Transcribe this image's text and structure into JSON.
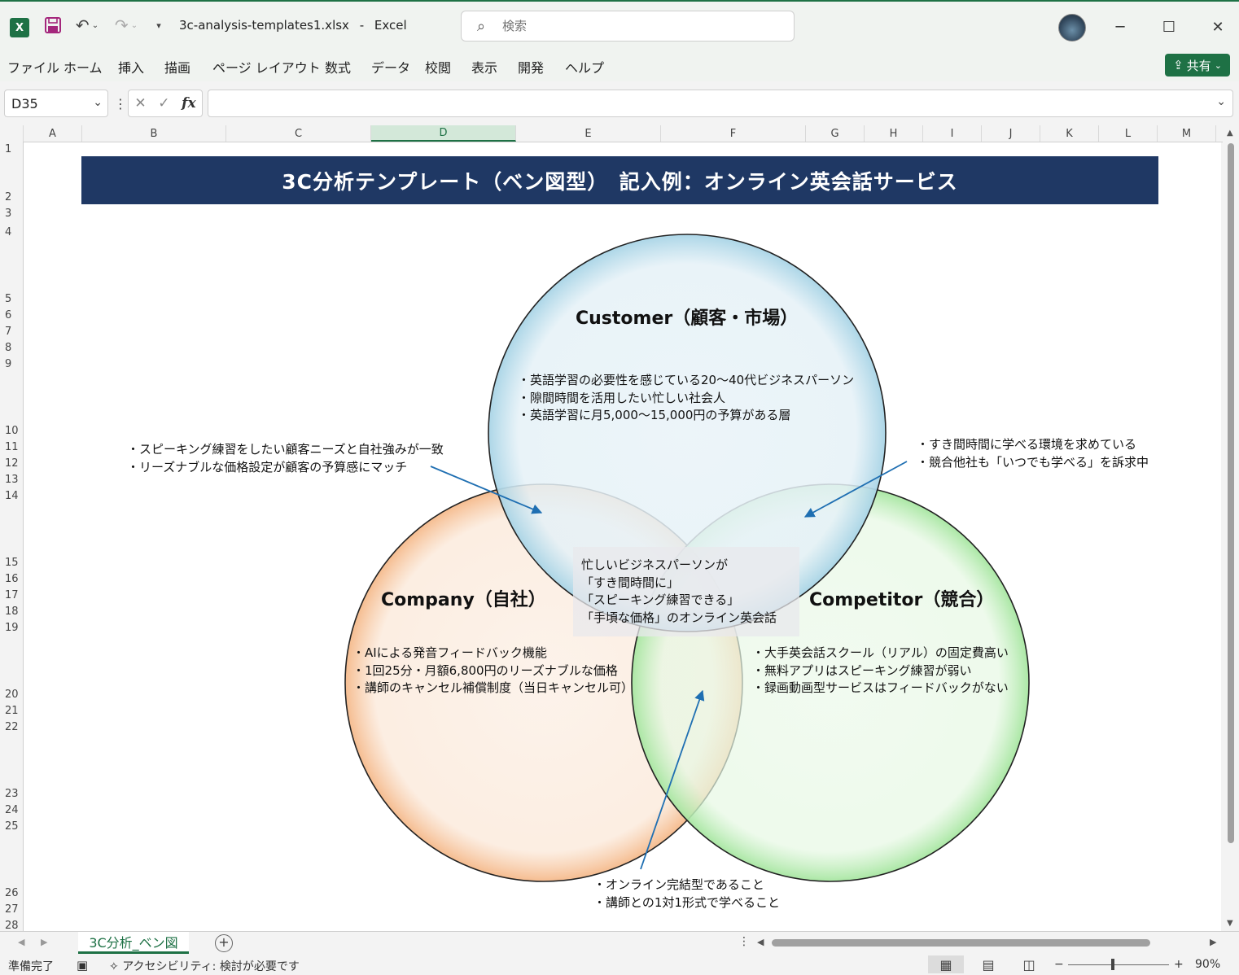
{
  "app": {
    "file_name": "3c-analysis-templates1.xlsx",
    "separator": "-",
    "app_name": "Excel",
    "logo_letter": "X",
    "accent_color": "#1e7145"
  },
  "search": {
    "placeholder": "検索"
  },
  "menu": {
    "items": [
      "ファイル",
      "ホーム",
      "挿入",
      "描画",
      "ページ レイアウト",
      "数式",
      "データ",
      "校閲",
      "表示",
      "開発",
      "ヘルプ"
    ],
    "share_label": "共有"
  },
  "formula_bar": {
    "name_box": "D35",
    "formula": ""
  },
  "columns": [
    "A",
    "B",
    "C",
    "D",
    "E",
    "F",
    "G",
    "H",
    "I",
    "J",
    "K",
    "L",
    "M"
  ],
  "selected_column": "D",
  "rows": [
    "1",
    "2",
    "3",
    "4",
    "5",
    "6",
    "7",
    "8",
    "9",
    "10",
    "11",
    "12",
    "13",
    "14",
    "15",
    "16",
    "17",
    "18",
    "19",
    "20",
    "21",
    "22",
    "23",
    "24",
    "25",
    "26",
    "27",
    "28"
  ],
  "sheet": {
    "title": "3C分析テンプレート（ベン図型）　記入例：オンライン英会話サービス",
    "title_bg": "#1f3864",
    "customer": {
      "label": "Customer（顧客・市場）",
      "lines": [
        "・英語学習の必要性を感じている20～40代ビジネスパーソン",
        "・隙間時間を活用したい忙しい社会人",
        "・英語学習に月5,000～15,000円の予算がある層"
      ],
      "color": "#a8d4e6"
    },
    "company": {
      "label": "Company（自社）",
      "lines": [
        "・AIによる発音フィードバック機能",
        "・1回25分・月額6,800円のリーズナブルな価格",
        "・講師のキャンセル補償制度（当日キャンセル可）"
      ],
      "color": "#f5b98a"
    },
    "competitor": {
      "label": "Competitor（競合）",
      "lines": [
        "・大手英会話スクール（リアル）の固定費高い",
        "・無料アプリはスピーキング練習が弱い",
        "・録画動画型サービスはフィードバックがない"
      ],
      "color": "#a6e6a0"
    },
    "center": {
      "lines": [
        "忙しいビジネスパーソンが",
        "「すき間時間に」",
        "「スピーキング練習できる」",
        "「手頃な価格」のオンライン英会話"
      ]
    },
    "note_customer_company": {
      "lines": [
        "・スピーキング練習をしたい顧客ニーズと自社強みが一致",
        "・リーズナブルな価格設定が顧客の予算感にマッチ"
      ]
    },
    "note_customer_competitor": {
      "lines": [
        "・すき間時間に学べる環境を求めている",
        "・競合他社も「いつでも学べる」を訴求中"
      ]
    },
    "note_company_competitor": {
      "lines": [
        "・オンライン完結型であること",
        "・講師との1対1形式で学べること"
      ]
    }
  },
  "tabs": {
    "active": "3C分析_ベン図"
  },
  "status": {
    "ready": "準備完了",
    "accessibility": "アクセシビリティ: 検討が必要です",
    "zoom_minus": "−",
    "zoom_plus": "+",
    "zoom": "90%"
  }
}
